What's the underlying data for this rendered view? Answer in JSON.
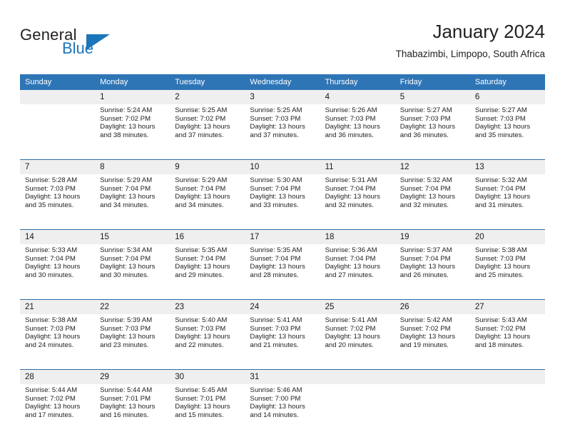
{
  "brand": {
    "name_part1": "General",
    "name_part2": "Blue",
    "logo_icon": "triangle-logo-icon",
    "accent_color": "#1b75bb"
  },
  "header": {
    "title": "January 2024",
    "subtitle": "Thabazimbi, Limpopo, South Africa"
  },
  "calendar": {
    "header_bg": "#2e75b6",
    "daynum_bg": "#efefef",
    "rule_color": "#2e6da4",
    "weekday_headers": [
      "Sunday",
      "Monday",
      "Tuesday",
      "Wednesday",
      "Thursday",
      "Friday",
      "Saturday"
    ],
    "weeks": [
      {
        "days": [
          {
            "num": "",
            "sunrise": "",
            "sunset": "",
            "daylight_line1": "",
            "daylight_line2": ""
          },
          {
            "num": "1",
            "sunrise": "Sunrise: 5:24 AM",
            "sunset": "Sunset: 7:02 PM",
            "daylight_line1": "Daylight: 13 hours",
            "daylight_line2": "and 38 minutes."
          },
          {
            "num": "2",
            "sunrise": "Sunrise: 5:25 AM",
            "sunset": "Sunset: 7:02 PM",
            "daylight_line1": "Daylight: 13 hours",
            "daylight_line2": "and 37 minutes."
          },
          {
            "num": "3",
            "sunrise": "Sunrise: 5:25 AM",
            "sunset": "Sunset: 7:03 PM",
            "daylight_line1": "Daylight: 13 hours",
            "daylight_line2": "and 37 minutes."
          },
          {
            "num": "4",
            "sunrise": "Sunrise: 5:26 AM",
            "sunset": "Sunset: 7:03 PM",
            "daylight_line1": "Daylight: 13 hours",
            "daylight_line2": "and 36 minutes."
          },
          {
            "num": "5",
            "sunrise": "Sunrise: 5:27 AM",
            "sunset": "Sunset: 7:03 PM",
            "daylight_line1": "Daylight: 13 hours",
            "daylight_line2": "and 36 minutes."
          },
          {
            "num": "6",
            "sunrise": "Sunrise: 5:27 AM",
            "sunset": "Sunset: 7:03 PM",
            "daylight_line1": "Daylight: 13 hours",
            "daylight_line2": "and 35 minutes."
          }
        ]
      },
      {
        "days": [
          {
            "num": "7",
            "sunrise": "Sunrise: 5:28 AM",
            "sunset": "Sunset: 7:03 PM",
            "daylight_line1": "Daylight: 13 hours",
            "daylight_line2": "and 35 minutes."
          },
          {
            "num": "8",
            "sunrise": "Sunrise: 5:29 AM",
            "sunset": "Sunset: 7:04 PM",
            "daylight_line1": "Daylight: 13 hours",
            "daylight_line2": "and 34 minutes."
          },
          {
            "num": "9",
            "sunrise": "Sunrise: 5:29 AM",
            "sunset": "Sunset: 7:04 PM",
            "daylight_line1": "Daylight: 13 hours",
            "daylight_line2": "and 34 minutes."
          },
          {
            "num": "10",
            "sunrise": "Sunrise: 5:30 AM",
            "sunset": "Sunset: 7:04 PM",
            "daylight_line1": "Daylight: 13 hours",
            "daylight_line2": "and 33 minutes."
          },
          {
            "num": "11",
            "sunrise": "Sunrise: 5:31 AM",
            "sunset": "Sunset: 7:04 PM",
            "daylight_line1": "Daylight: 13 hours",
            "daylight_line2": "and 32 minutes."
          },
          {
            "num": "12",
            "sunrise": "Sunrise: 5:32 AM",
            "sunset": "Sunset: 7:04 PM",
            "daylight_line1": "Daylight: 13 hours",
            "daylight_line2": "and 32 minutes."
          },
          {
            "num": "13",
            "sunrise": "Sunrise: 5:32 AM",
            "sunset": "Sunset: 7:04 PM",
            "daylight_line1": "Daylight: 13 hours",
            "daylight_line2": "and 31 minutes."
          }
        ]
      },
      {
        "days": [
          {
            "num": "14",
            "sunrise": "Sunrise: 5:33 AM",
            "sunset": "Sunset: 7:04 PM",
            "daylight_line1": "Daylight: 13 hours",
            "daylight_line2": "and 30 minutes."
          },
          {
            "num": "15",
            "sunrise": "Sunrise: 5:34 AM",
            "sunset": "Sunset: 7:04 PM",
            "daylight_line1": "Daylight: 13 hours",
            "daylight_line2": "and 30 minutes."
          },
          {
            "num": "16",
            "sunrise": "Sunrise: 5:35 AM",
            "sunset": "Sunset: 7:04 PM",
            "daylight_line1": "Daylight: 13 hours",
            "daylight_line2": "and 29 minutes."
          },
          {
            "num": "17",
            "sunrise": "Sunrise: 5:35 AM",
            "sunset": "Sunset: 7:04 PM",
            "daylight_line1": "Daylight: 13 hours",
            "daylight_line2": "and 28 minutes."
          },
          {
            "num": "18",
            "sunrise": "Sunrise: 5:36 AM",
            "sunset": "Sunset: 7:04 PM",
            "daylight_line1": "Daylight: 13 hours",
            "daylight_line2": "and 27 minutes."
          },
          {
            "num": "19",
            "sunrise": "Sunrise: 5:37 AM",
            "sunset": "Sunset: 7:04 PM",
            "daylight_line1": "Daylight: 13 hours",
            "daylight_line2": "and 26 minutes."
          },
          {
            "num": "20",
            "sunrise": "Sunrise: 5:38 AM",
            "sunset": "Sunset: 7:03 PM",
            "daylight_line1": "Daylight: 13 hours",
            "daylight_line2": "and 25 minutes."
          }
        ]
      },
      {
        "days": [
          {
            "num": "21",
            "sunrise": "Sunrise: 5:38 AM",
            "sunset": "Sunset: 7:03 PM",
            "daylight_line1": "Daylight: 13 hours",
            "daylight_line2": "and 24 minutes."
          },
          {
            "num": "22",
            "sunrise": "Sunrise: 5:39 AM",
            "sunset": "Sunset: 7:03 PM",
            "daylight_line1": "Daylight: 13 hours",
            "daylight_line2": "and 23 minutes."
          },
          {
            "num": "23",
            "sunrise": "Sunrise: 5:40 AM",
            "sunset": "Sunset: 7:03 PM",
            "daylight_line1": "Daylight: 13 hours",
            "daylight_line2": "and 22 minutes."
          },
          {
            "num": "24",
            "sunrise": "Sunrise: 5:41 AM",
            "sunset": "Sunset: 7:03 PM",
            "daylight_line1": "Daylight: 13 hours",
            "daylight_line2": "and 21 minutes."
          },
          {
            "num": "25",
            "sunrise": "Sunrise: 5:41 AM",
            "sunset": "Sunset: 7:02 PM",
            "daylight_line1": "Daylight: 13 hours",
            "daylight_line2": "and 20 minutes."
          },
          {
            "num": "26",
            "sunrise": "Sunrise: 5:42 AM",
            "sunset": "Sunset: 7:02 PM",
            "daylight_line1": "Daylight: 13 hours",
            "daylight_line2": "and 19 minutes."
          },
          {
            "num": "27",
            "sunrise": "Sunrise: 5:43 AM",
            "sunset": "Sunset: 7:02 PM",
            "daylight_line1": "Daylight: 13 hours",
            "daylight_line2": "and 18 minutes."
          }
        ]
      },
      {
        "days": [
          {
            "num": "28",
            "sunrise": "Sunrise: 5:44 AM",
            "sunset": "Sunset: 7:02 PM",
            "daylight_line1": "Daylight: 13 hours",
            "daylight_line2": "and 17 minutes."
          },
          {
            "num": "29",
            "sunrise": "Sunrise: 5:44 AM",
            "sunset": "Sunset: 7:01 PM",
            "daylight_line1": "Daylight: 13 hours",
            "daylight_line2": "and 16 minutes."
          },
          {
            "num": "30",
            "sunrise": "Sunrise: 5:45 AM",
            "sunset": "Sunset: 7:01 PM",
            "daylight_line1": "Daylight: 13 hours",
            "daylight_line2": "and 15 minutes."
          },
          {
            "num": "31",
            "sunrise": "Sunrise: 5:46 AM",
            "sunset": "Sunset: 7:00 PM",
            "daylight_line1": "Daylight: 13 hours",
            "daylight_line2": "and 14 minutes."
          },
          {
            "num": "",
            "sunrise": "",
            "sunset": "",
            "daylight_line1": "",
            "daylight_line2": ""
          },
          {
            "num": "",
            "sunrise": "",
            "sunset": "",
            "daylight_line1": "",
            "daylight_line2": ""
          },
          {
            "num": "",
            "sunrise": "",
            "sunset": "",
            "daylight_line1": "",
            "daylight_line2": ""
          }
        ]
      }
    ]
  }
}
